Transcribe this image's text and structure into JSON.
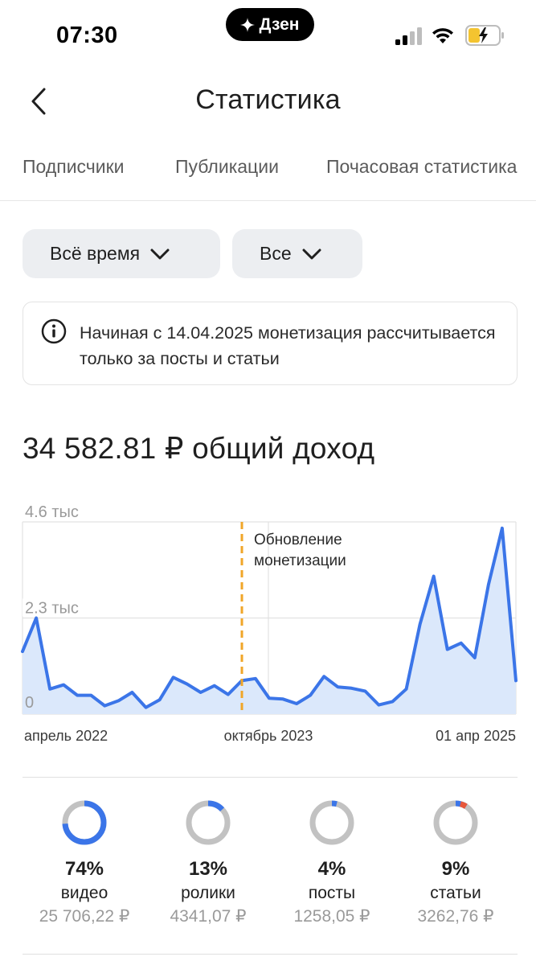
{
  "status_bar": {
    "time": "07:30",
    "brand": "Дзен"
  },
  "header": {
    "title": "Статистика"
  },
  "tabs": [
    {
      "label": "Подписчики"
    },
    {
      "label": "Публикации"
    },
    {
      "label": "Почасовая статистика"
    }
  ],
  "filters": [
    {
      "label": "Всё время"
    },
    {
      "label": "Все"
    }
  ],
  "info": {
    "text": "Начиная с 14.04.2025 монетизация рассчитывается только за посты и статьи"
  },
  "summary": {
    "total": "34 582.81 ₽ общий доход"
  },
  "colors": {
    "line": "#3b75e8",
    "fill": "#dbe8fb",
    "marker": "#f0a628",
    "track": "#c2c2c2",
    "accent_red": "#e8573a"
  },
  "chart_data": {
    "type": "area",
    "y_tick_labels": [
      "4.6 тыс",
      "2.3 тыс",
      "0"
    ],
    "y_ticks": [
      4600,
      2300,
      0
    ],
    "ylim": [
      0,
      4600
    ],
    "x_tick_labels": [
      "апрель 2022",
      "октябрь 2023",
      "01 апр 2025"
    ],
    "annotation": {
      "line1": "Обновление",
      "line2": "монетизации"
    },
    "series": [
      {
        "values": [
          1500,
          2300,
          600,
          700,
          450,
          450,
          200,
          320,
          520,
          160,
          340,
          880,
          720,
          520,
          680,
          470,
          800,
          850,
          380,
          360,
          250,
          450,
          900,
          650,
          620,
          550,
          220,
          300,
          600,
          2150,
          3300,
          1550,
          1700,
          1350,
          3100,
          4450,
          800
        ]
      }
    ],
    "grid": true
  },
  "breakdown": [
    {
      "pct": "74%",
      "label": "видео",
      "amount": "25 706,22 ₽",
      "share": 0.74
    },
    {
      "pct": "13%",
      "label": "ролики",
      "amount": "4341,07 ₽",
      "share": 0.13
    },
    {
      "pct": "4%",
      "label": "посты",
      "amount": "1258,05 ₽",
      "share": 0.04
    },
    {
      "pct": "9%",
      "label": "статьи",
      "amount": "3262,76 ₽",
      "share": 0.09
    }
  ]
}
